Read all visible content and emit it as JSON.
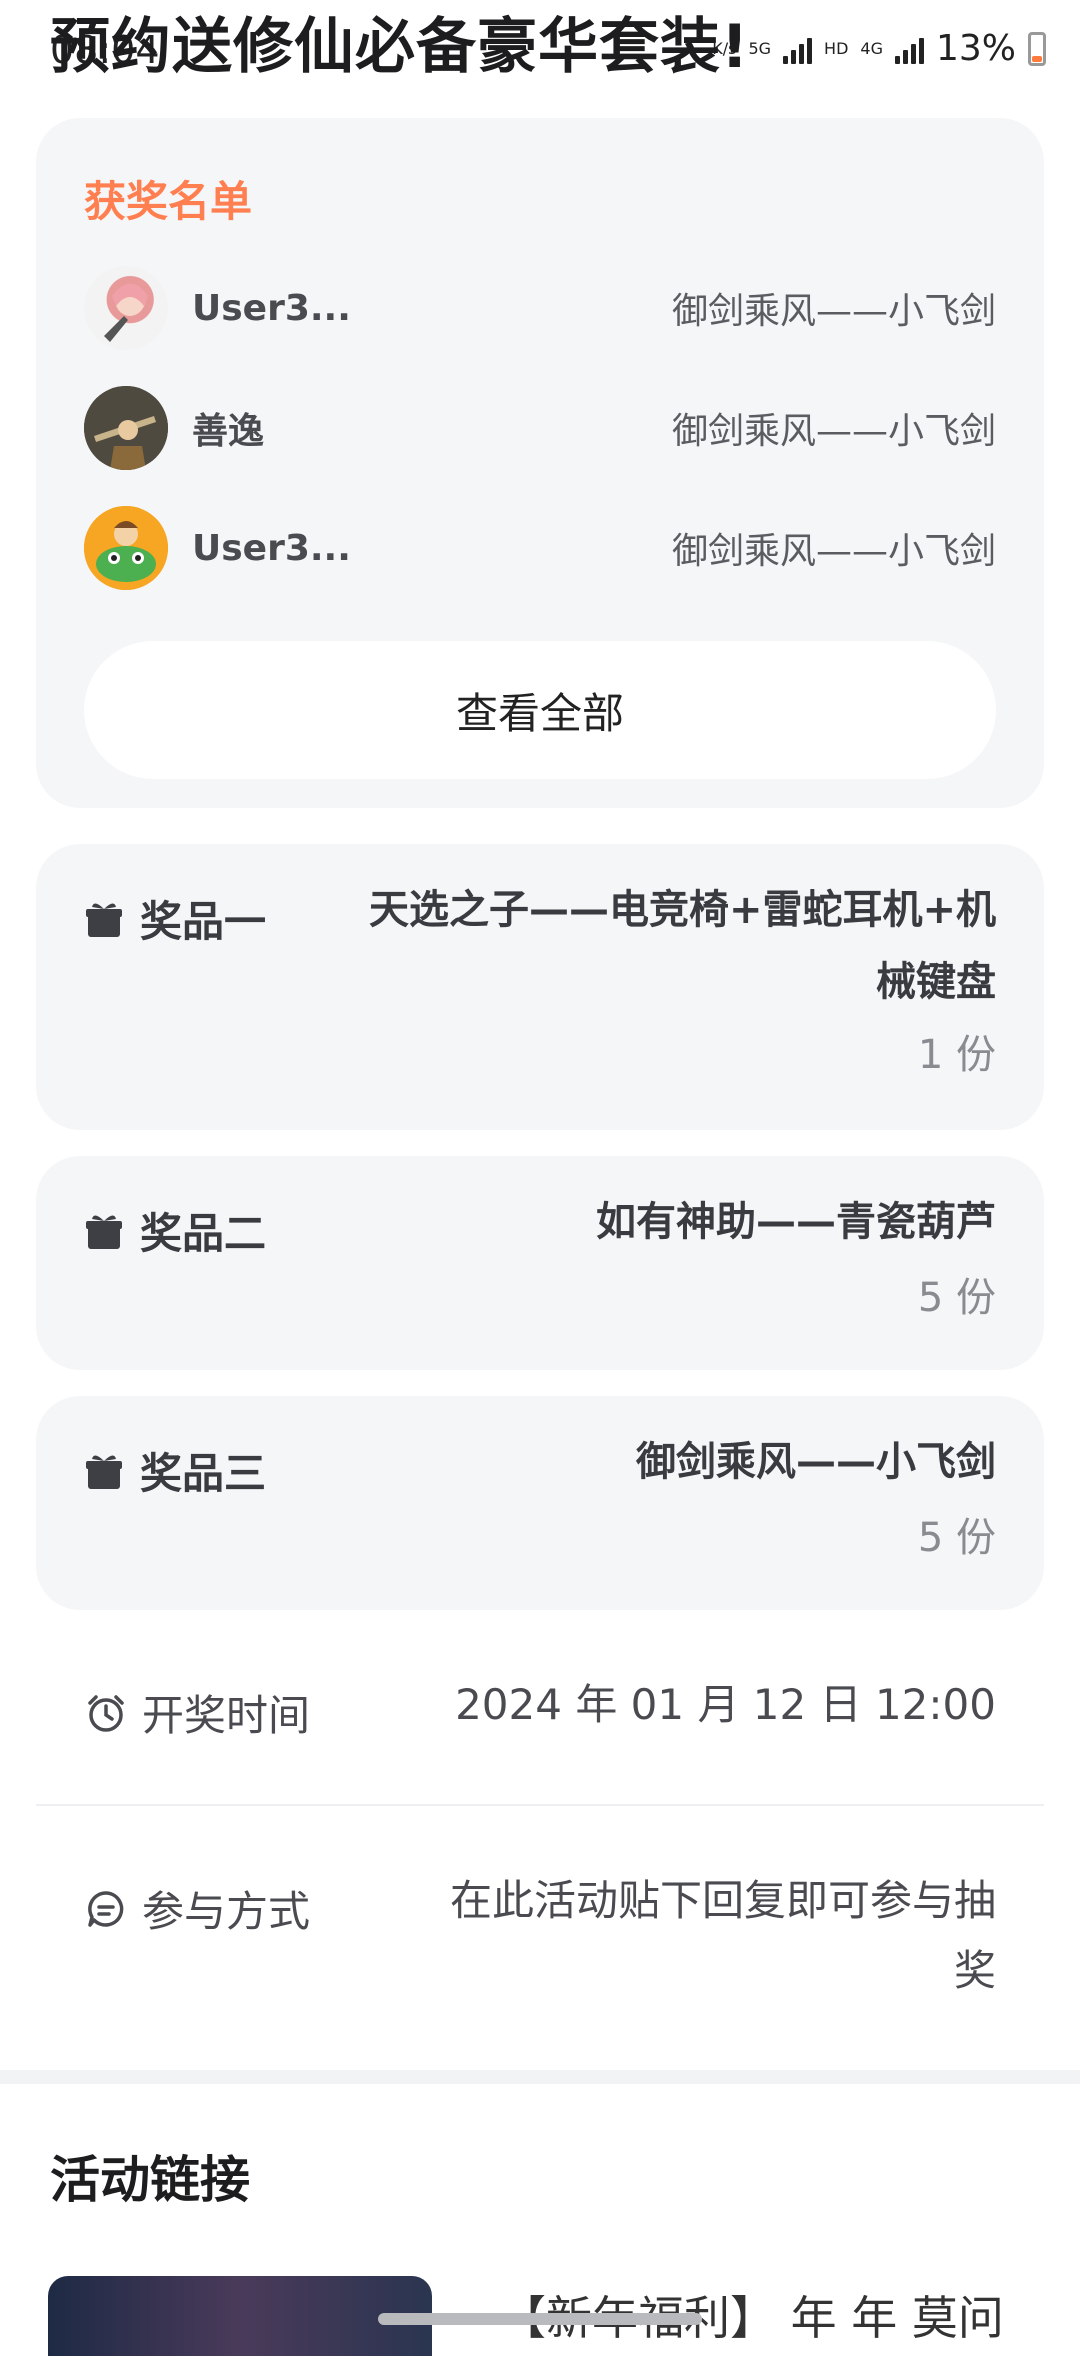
{
  "status_bar": {
    "time": "08:04",
    "net_speed": "K/s",
    "net_5g": "5G",
    "hd1": "HD",
    "net_4g": "4G",
    "hd2": "HD",
    "battery": "13%"
  },
  "page": {
    "title": "预约送修仙必备豪华套装!"
  },
  "winners": {
    "title": "获奖名单",
    "items": [
      {
        "name": "User3...",
        "prize": "御剑乘风——小飞剑",
        "avatar": "anime-girl-avatar"
      },
      {
        "name": "善逸",
        "prize": "御剑乘风——小飞剑",
        "avatar": "swordsman-avatar"
      },
      {
        "name": "User3...",
        "prize": "御剑乘风——小飞剑",
        "avatar": "cartoon-creature-avatar"
      }
    ],
    "view_all_label": "查看全部"
  },
  "prizes": [
    {
      "label": "奖品一",
      "name": "天选之子——电竞椅+雷蛇耳机+机械键盘",
      "count": "1 份"
    },
    {
      "label": "奖品二",
      "name": "如有神助——青瓷葫芦",
      "count": "5 份"
    },
    {
      "label": "奖品三",
      "name": "御剑乘风——小飞剑",
      "count": "5 份"
    }
  ],
  "draw_time": {
    "label": "开奖时间",
    "value": "2024 年 01 月 12 日 12:00",
    "icon": "alarm-clock-icon"
  },
  "participation": {
    "label": "参与方式",
    "value": "在此活动贴下回复即可参与抽奖",
    "icon": "chat-bubble-icon"
  },
  "links": {
    "title": "活动链接",
    "first_item_text": "【新年福利】 年 年 莫问"
  },
  "colors": {
    "accent": "#ff7f50",
    "card_bg": "#f5f6f8",
    "muted": "#8a8b90"
  }
}
